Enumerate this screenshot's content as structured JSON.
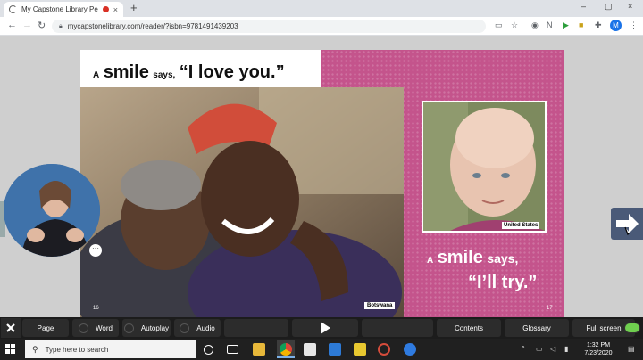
{
  "browser": {
    "tab_title": "My Capstone Library People",
    "tab_close": "×",
    "new_tab": "+",
    "url": "mycapstonelibrary.com/reader/?isbn=9781491439203",
    "profile_initial": "M",
    "window_controls": [
      "–",
      "▢",
      "×"
    ]
  },
  "book": {
    "left_page": {
      "heading_article": "A",
      "heading_word": "smile",
      "heading_says": "says,",
      "heading_quote": "“I love you.”",
      "caption": "Botswana",
      "page_number": "16"
    },
    "right_page": {
      "caption": "United States",
      "heading_article": "A",
      "heading_word": "smile",
      "heading_says": "says,",
      "heading_quote": "“I’ll try.”",
      "page_number": "17"
    }
  },
  "toolbar": {
    "page": "Page",
    "word": "Word",
    "autoplay": "Autoplay",
    "audio": "Audio",
    "contents": "Contents",
    "glossary": "Glossary",
    "full_screen": "Full screen"
  },
  "taskbar": {
    "search_placeholder": "Type here to search",
    "time": "1:32 PM",
    "date": "7/23/2020"
  },
  "colors": {
    "right_page": "#c4548c",
    "toolbar": "#1c1c1c",
    "taskbar": "#202020"
  }
}
